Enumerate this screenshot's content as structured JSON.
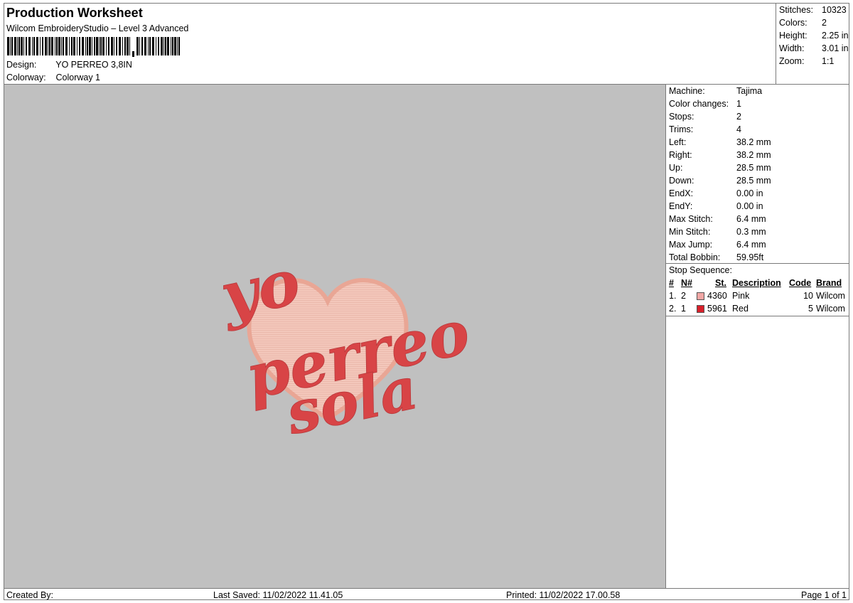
{
  "header": {
    "title": "Production Worksheet",
    "subtitle": "Wilcom EmbroideryStudio – Level 3 Advanced",
    "design_label": "Design:",
    "design_value": "YO PERREO 3,8IN",
    "colorway_label": "Colorway:",
    "colorway_value": "Colorway 1"
  },
  "summary": {
    "stitches_label": "Stitches:",
    "stitches_value": "10323",
    "colors_label": "Colors:",
    "colors_value": "2",
    "height_label": "Height:",
    "height_value": "2.25 in",
    "width_label": "Width:",
    "width_value": "3.01 in",
    "zoom_label": "Zoom:",
    "zoom_value": "1:1"
  },
  "design": {
    "line1": "yo",
    "line2": "perreo",
    "line3": "sola",
    "colors": {
      "heart_fill": "#f2c3b7",
      "heart_outline": "#e8a292",
      "text": "#d84446",
      "background": "#c0c0c0"
    }
  },
  "machine": {
    "rows": [
      {
        "label": "Machine:",
        "value": "Tajima"
      },
      {
        "label": "Color changes:",
        "value": "1"
      },
      {
        "label": "Stops:",
        "value": "2"
      },
      {
        "label": "Trims:",
        "value": "4"
      },
      {
        "label": "Left:",
        "value": "38.2 mm"
      },
      {
        "label": "Right:",
        "value": "38.2 mm"
      },
      {
        "label": "Up:",
        "value": "28.5 mm"
      },
      {
        "label": "Down:",
        "value": "28.5 mm"
      },
      {
        "label": "EndX:",
        "value": "0.00 in"
      },
      {
        "label": "EndY:",
        "value": "0.00 in"
      },
      {
        "label": "Max Stitch:",
        "value": "6.4 mm"
      },
      {
        "label": "Min Stitch:",
        "value": "0.3 mm"
      },
      {
        "label": "Max Jump:",
        "value": "6.4 mm"
      },
      {
        "label": "Total Bobbin:",
        "value": "59.95ft"
      }
    ]
  },
  "stop_sequence": {
    "title": "Stop Sequence:",
    "headers": {
      "num": "#",
      "n": "N#",
      "st": "St.",
      "description": "Description",
      "code": "Code",
      "brand": "Brand"
    },
    "rows": [
      {
        "num": "1.",
        "n": "2",
        "color": "#f0a6a4",
        "st": "4360",
        "description": "Pink",
        "code": "10",
        "brand": "Wilcom"
      },
      {
        "num": "2.",
        "n": "1",
        "color": "#d8202a",
        "st": "5961",
        "description": "Red",
        "code": "5",
        "brand": "Wilcom"
      }
    ]
  },
  "footer": {
    "created_by": "Created By:",
    "last_saved": "Last Saved: 11/02/2022 11.41.05",
    "printed": "Printed: 11/02/2022 17.00.58",
    "page": "Page 1 of 1"
  }
}
